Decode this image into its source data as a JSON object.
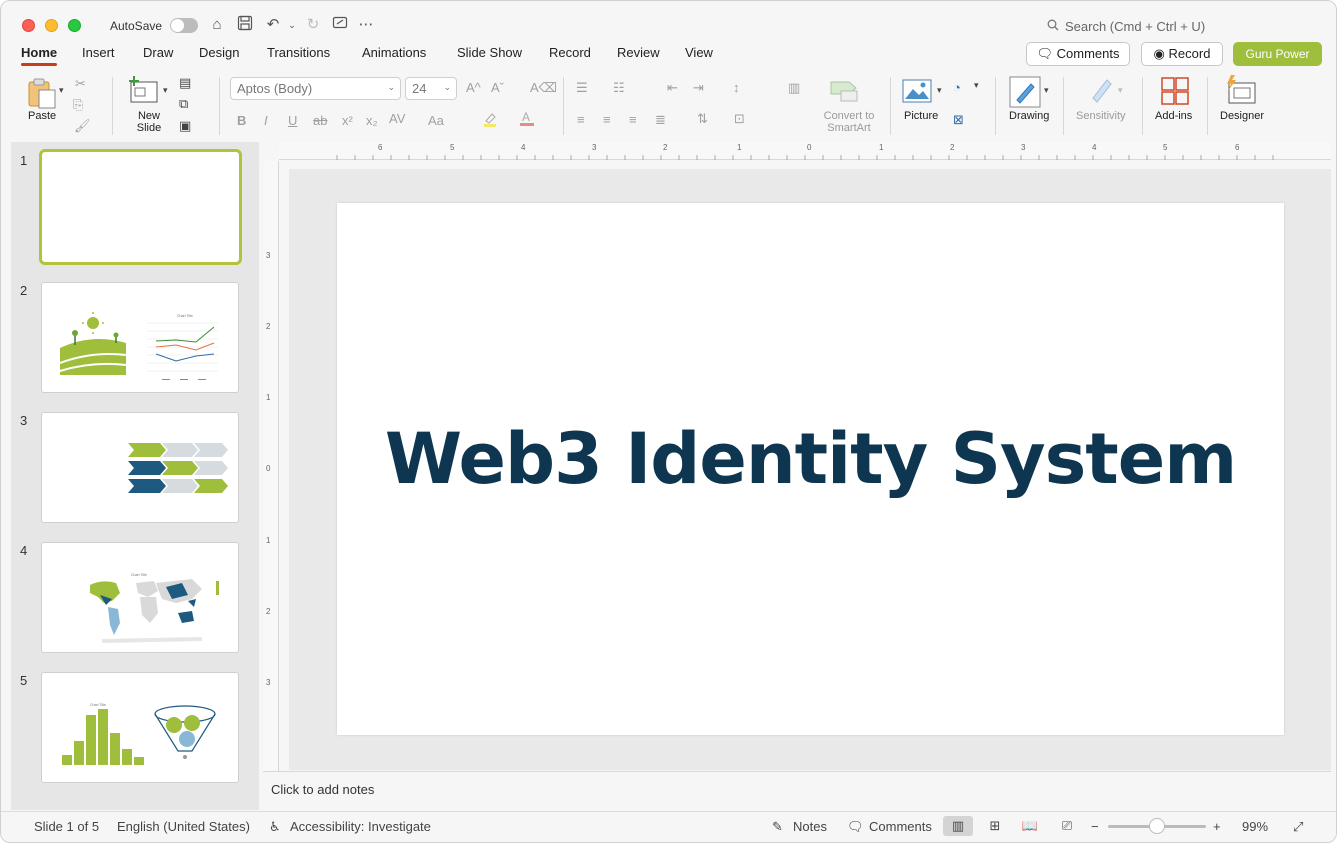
{
  "titlebar": {
    "autosave_label": "AutoSave",
    "search_placeholder": "Search (Cmd + Ctrl + U)"
  },
  "tabs": [
    {
      "label": "Home",
      "active": true
    },
    {
      "label": "Insert"
    },
    {
      "label": "Draw"
    },
    {
      "label": "Design"
    },
    {
      "label": "Transitions"
    },
    {
      "label": "Animations"
    },
    {
      "label": "Slide Show"
    },
    {
      "label": "Record"
    },
    {
      "label": "Review"
    },
    {
      "label": "View"
    }
  ],
  "actions": {
    "comments_label": "Comments",
    "record_label": "Record",
    "guru_label": "Guru Power"
  },
  "ribbon": {
    "paste_label": "Paste",
    "new_slide_label": "New Slide",
    "font_name": "Aptos (Body)",
    "font_size": "24",
    "convert_smartart_label": "Convert to SmartArt",
    "picture_label": "Picture",
    "drawing_label": "Drawing",
    "sensitivity_label": "Sensitivity",
    "addins_label": "Add-ins",
    "designer_label": "Designer"
  },
  "slides": [
    {
      "number": "1",
      "selected": true
    },
    {
      "number": "2"
    },
    {
      "number": "3"
    },
    {
      "number": "4"
    },
    {
      "number": "5"
    }
  ],
  "ruler": {
    "top_labels": [
      "6",
      "5",
      "4",
      "3",
      "2",
      "1",
      "0",
      "1",
      "2",
      "3",
      "4",
      "5",
      "6"
    ],
    "left_labels": [
      "3",
      "2",
      "1",
      "0",
      "1",
      "2",
      "3"
    ]
  },
  "slide": {
    "title": "Web3 Identity System"
  },
  "notes": {
    "placeholder": "Click to add notes"
  },
  "status": {
    "slide_count": "Slide 1 of 5",
    "language": "English (United States)",
    "accessibility": "Accessibility: Investigate",
    "notes_label": "Notes",
    "comments_label": "Comments",
    "zoom": "99%"
  },
  "colors": {
    "accent_green": "#9fbe3b",
    "title_navy": "#0e3651",
    "tab_underline": "#c43e1c"
  }
}
